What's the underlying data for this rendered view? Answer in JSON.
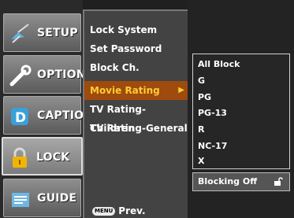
{
  "tabs": [
    {
      "label": "SETUP",
      "icon": "satellite-dish-icon"
    },
    {
      "label": "OPTION",
      "icon": "tools-icon"
    },
    {
      "label": "CAPTION",
      "icon": "caption-icon"
    },
    {
      "label": "LOCK",
      "icon": "padlock-icon",
      "active": true
    },
    {
      "label": "GUIDE",
      "icon": "guide-icon"
    }
  ],
  "menu": {
    "items": [
      "Lock System",
      "Set Password",
      "Block Ch.",
      "Movie Rating",
      "TV Rating-Children",
      "TV Rating-General"
    ],
    "selected": "Movie Rating",
    "footer_button": "MENU",
    "footer_label": "Prev."
  },
  "submenu": {
    "options": [
      "All Block",
      "G",
      "PG",
      "PG-13",
      "R",
      "NC-17",
      "X"
    ],
    "status": "Blocking Off"
  },
  "colors": {
    "selected_bg": "#9e4b0d",
    "selected_text": "#ffcc33"
  }
}
